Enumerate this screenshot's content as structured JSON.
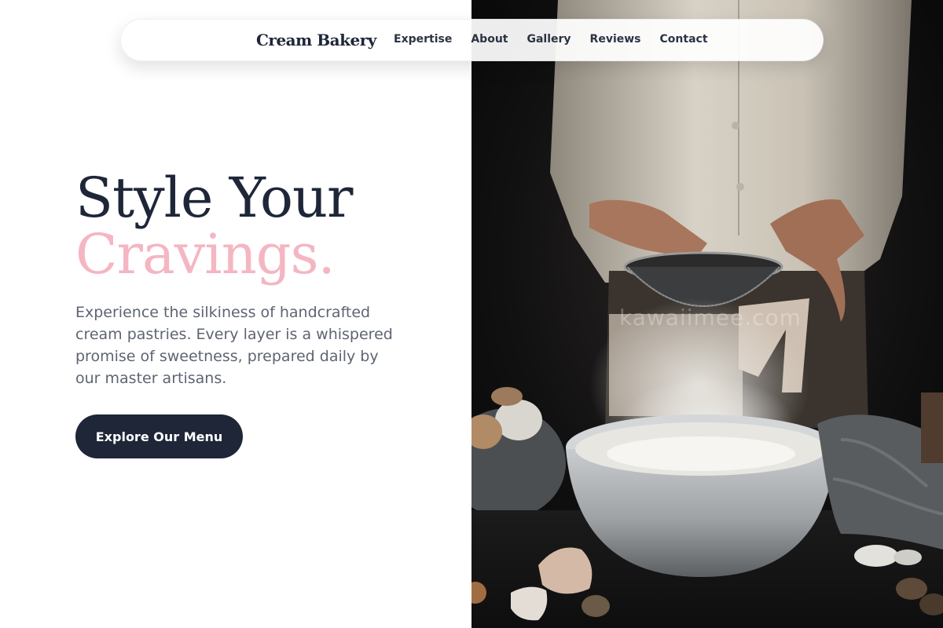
{
  "nav": {
    "brand": "Cream Bakery",
    "links": [
      "Expertise",
      "About",
      "Gallery",
      "Reviews",
      "Contact"
    ]
  },
  "hero": {
    "headline_line1": "Style Your",
    "headline_line2": "Cravings.",
    "description": "Experience the silkiness of handcrafted cream pastries. Every layer is a whispered promise of sweetness, prepared daily by our master artisans.",
    "cta_label": "Explore Our Menu",
    "photo_watermark": "kawaiimee.com"
  },
  "colors": {
    "primary_dark": "#1e2638",
    "accent_pink": "#f4b6c2",
    "body_text": "#5e6472",
    "photo_background": "#0c0c0d"
  }
}
